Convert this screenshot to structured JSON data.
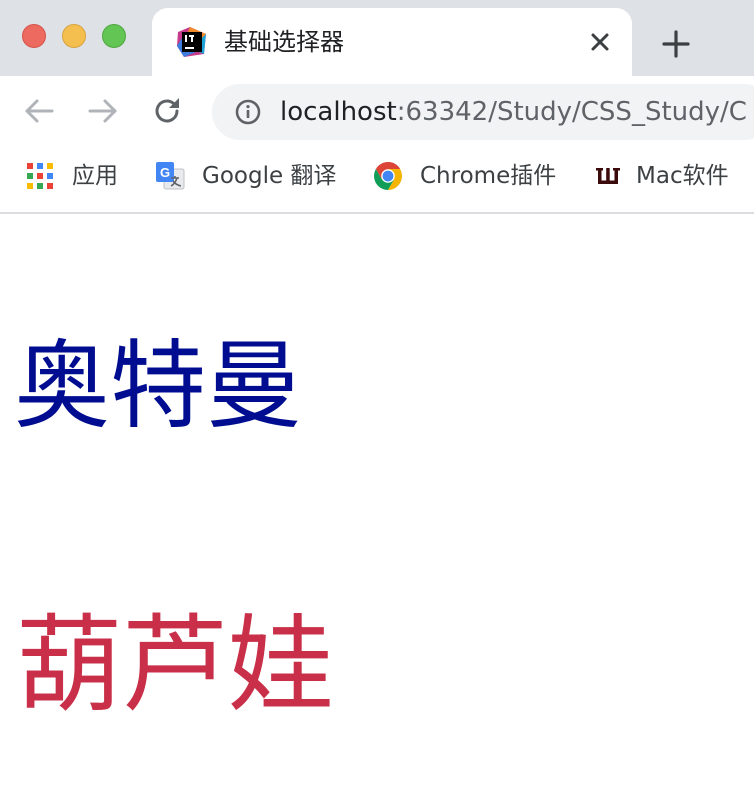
{
  "browser": {
    "tab": {
      "title": "基础选择器",
      "favicon": "intellij-favicon-icon"
    },
    "address_bar": {
      "host": "localhost",
      "rest": ":63342/Study/CSS_Study/C"
    },
    "bookmarks": [
      {
        "label": "应用",
        "icon": "apps-grid-icon"
      },
      {
        "label": "Google 翻译",
        "icon": "google-translate-icon"
      },
      {
        "label": "Chrome插件",
        "icon": "chrome-icon"
      },
      {
        "label": "Mac软件",
        "icon": "w-logo-icon"
      }
    ]
  },
  "page": {
    "heading_1": {
      "text": "奥特曼",
      "color": "#000d91"
    },
    "heading_2": {
      "text": "葫芦娃",
      "color": "#c92f48"
    }
  }
}
